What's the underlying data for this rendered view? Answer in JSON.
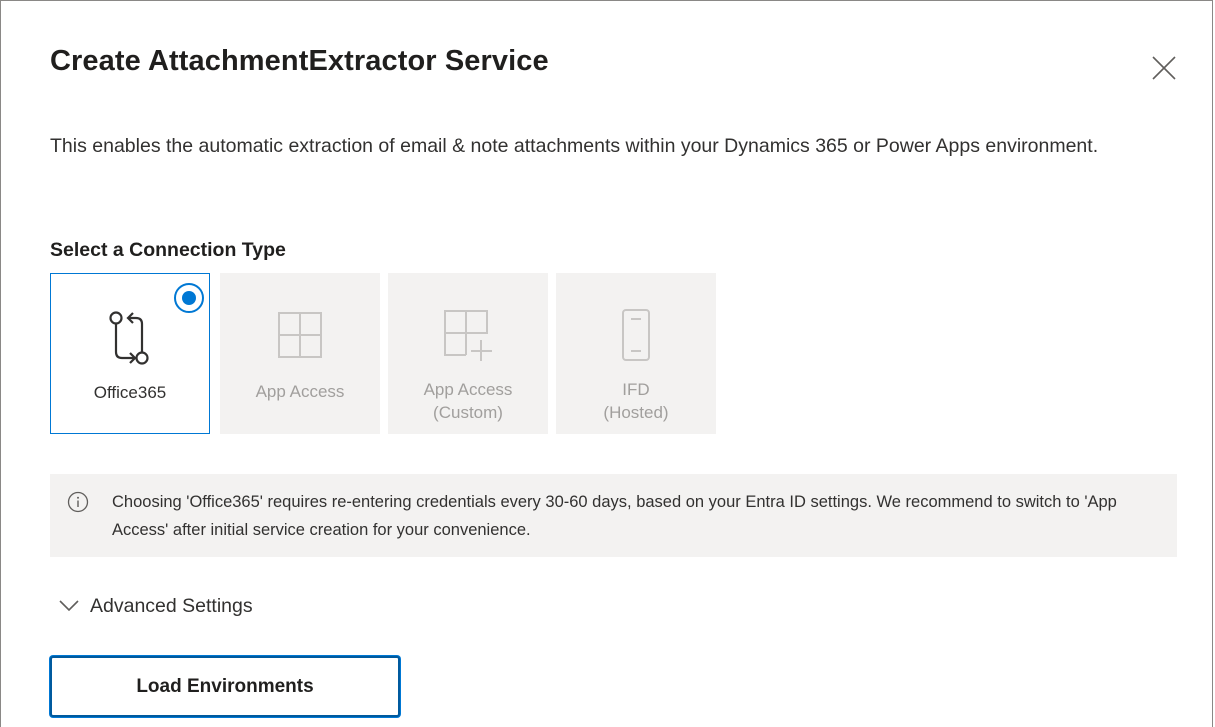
{
  "dialog": {
    "title": "Create AttachmentExtractor Service",
    "close_icon": "close-icon",
    "description": "This enables the automatic extraction of email & note attachments within your Dynamics 365 or Power Apps environment."
  },
  "connection": {
    "label": "Select a Connection Type",
    "options": [
      {
        "label": "Office365",
        "icon": "flow-switch-icon",
        "selected": true,
        "enabled": true
      },
      {
        "label": "App Access",
        "icon": "app-grid-icon",
        "selected": false,
        "enabled": false
      },
      {
        "label": "App Access\n(Custom)",
        "icon": "app-grid-add-icon",
        "selected": false,
        "enabled": false
      },
      {
        "label": "IFD\n(Hosted)",
        "icon": "mobile-device-icon",
        "selected": false,
        "enabled": false
      }
    ]
  },
  "info": {
    "icon": "info-icon",
    "text": "Choosing 'Office365' requires re-entering credentials every 30-60 days, based on your Entra ID settings. We recommend to switch to 'App Access' after initial service creation for your convenience."
  },
  "advanced": {
    "icon": "chevron-down-icon",
    "label": "Advanced Settings"
  },
  "actions": {
    "load_label": "Load Environments"
  },
  "colors": {
    "accent": "#0078d4",
    "tile_disabled_bg": "#f3f2f1",
    "text": "#323130",
    "muted": "#a19f9d"
  }
}
